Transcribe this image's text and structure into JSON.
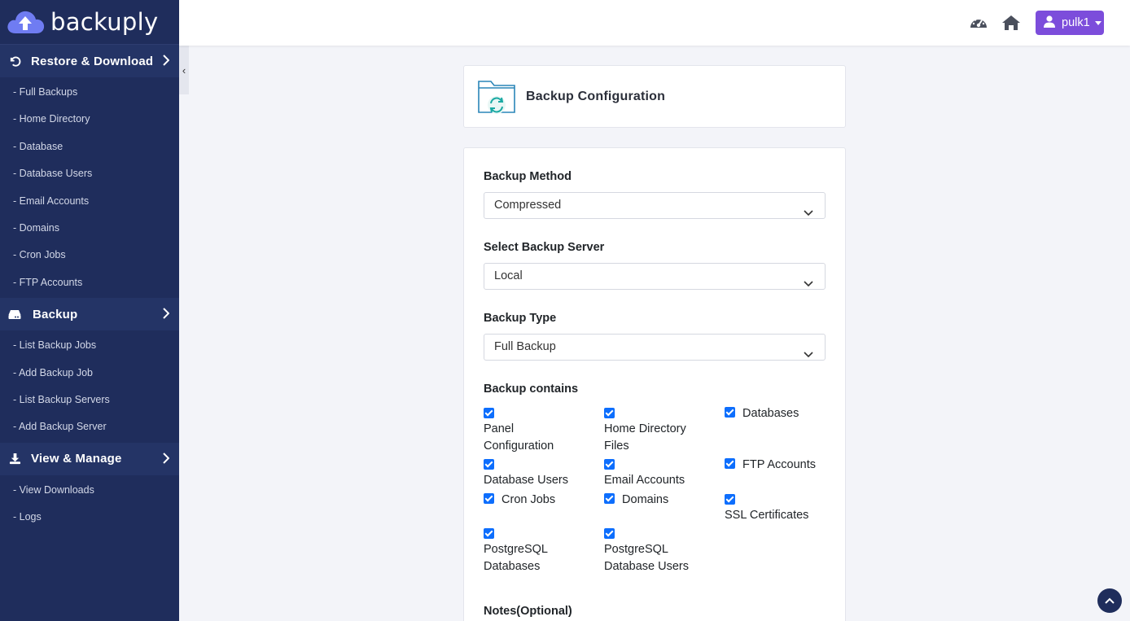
{
  "brand": {
    "name": "backuply"
  },
  "sidebar": {
    "sections": [
      {
        "label": "Restore & Download",
        "icon": "undo-icon",
        "items": [
          "- Full Backups",
          "- Home Directory",
          "- Database",
          "- Database Users",
          "- Email Accounts",
          "- Domains",
          "- Cron Jobs",
          "- FTP Accounts"
        ]
      },
      {
        "label": "Backup",
        "icon": "hard-drive-icon",
        "items": [
          "- List Backup Jobs",
          "- Add Backup Job",
          "- List Backup Servers",
          "- Add Backup Server"
        ]
      },
      {
        "label": "View & Manage",
        "icon": "download-icon",
        "items": [
          "- View Downloads",
          "- Logs"
        ]
      }
    ],
    "collapse_glyph": "‹"
  },
  "topbar": {
    "user": "pulk1"
  },
  "page": {
    "title": "Backup Configuration"
  },
  "form": {
    "backup_method": {
      "label": "Backup Method",
      "value": "Compressed"
    },
    "backup_server": {
      "label": "Select Backup Server",
      "value": "Local"
    },
    "backup_type": {
      "label": "Backup Type",
      "value": "Full Backup"
    },
    "contains": {
      "label": "Backup contains",
      "items": [
        {
          "label": "Panel Configuration",
          "checked": true
        },
        {
          "label": "Home Directory Files",
          "checked": true
        },
        {
          "label": "Databases",
          "checked": true
        },
        {
          "label": "Database Users",
          "checked": true
        },
        {
          "label": "Email Accounts",
          "checked": true
        },
        {
          "label": "FTP Accounts",
          "checked": true
        },
        {
          "label": "Cron Jobs",
          "checked": true
        },
        {
          "label": "Domains",
          "checked": true
        },
        {
          "label": "SSL Certificates",
          "checked": true
        },
        {
          "label": "PostgreSQL Databases",
          "checked": true
        },
        {
          "label": "PostgreSQL Database Users",
          "checked": true
        }
      ]
    },
    "notes_label": "Notes(Optional)"
  },
  "colors": {
    "sidebar": "#1f2d5c",
    "accent": "#7c4ddb",
    "checkbox": "#0d6efd",
    "folder": "#1aa9a3"
  }
}
